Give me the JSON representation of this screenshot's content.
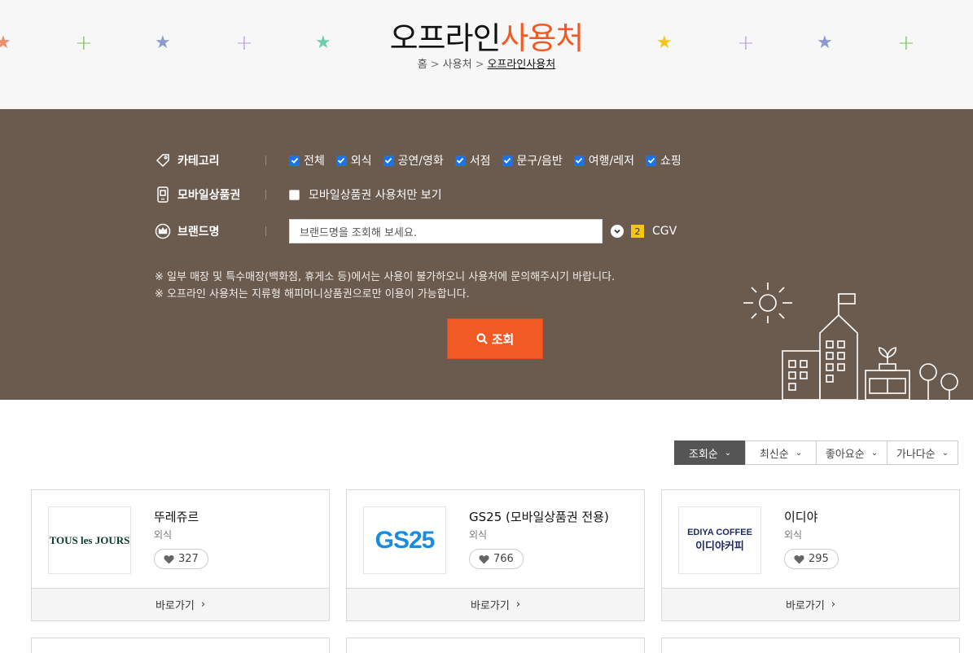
{
  "hero": {
    "title_main": "오프라인",
    "title_accent": "사용처",
    "breadcrumb": [
      "홈",
      "사용처",
      "오프라인사용처"
    ],
    "colors": {
      "accent": "#f15a24"
    }
  },
  "filter": {
    "category": {
      "label": "카테고리",
      "icon": "tag-icon",
      "options": [
        "전체",
        "외식",
        "공연/영화",
        "서점",
        "문구/음반",
        "여행/레저",
        "쇼핑"
      ]
    },
    "mobile": {
      "label": "모바일상품권",
      "icon": "mobile-icon",
      "checkbox_label": "모바일상품권 사용처만 보기"
    },
    "brand": {
      "label": "브랜드명",
      "icon": "crown-icon",
      "placeholder": "브랜드명을 조회해 보세요.",
      "count": "2",
      "value": "CGV"
    },
    "notes": [
      "※ 일부 매장 및 특수매장(백화점, 휴게소 등)에서는 사용이 불가하오니 사용처에 문의해주시기 바랍니다.",
      "※ 오프라인 사용처는 지류형 해피머니상품권으로만 이용이 가능합니다."
    ],
    "search_label": "조회",
    "colors": {
      "panel": "#6b5a4e",
      "button": "#f15a24"
    }
  },
  "sort": {
    "options": [
      "조회순",
      "최신순",
      "좋아요순",
      "가나다순"
    ],
    "active": "조회순"
  },
  "stores": [
    {
      "name": "뚜레쥬르",
      "category": "외식",
      "likes": "327",
      "logo_text": "TOUS les JOURS",
      "go_label": "바로가기"
    },
    {
      "name": "GS25 (모바일상품권 전용)",
      "category": "외식",
      "likes": "766",
      "logo_text": "GS25",
      "go_label": "바로가기"
    },
    {
      "name": "이디야",
      "category": "외식",
      "likes": "295",
      "logo_text_1": "EDIYA COFFEE",
      "logo_text_2": "이디야커피",
      "go_label": "바로가기"
    }
  ]
}
